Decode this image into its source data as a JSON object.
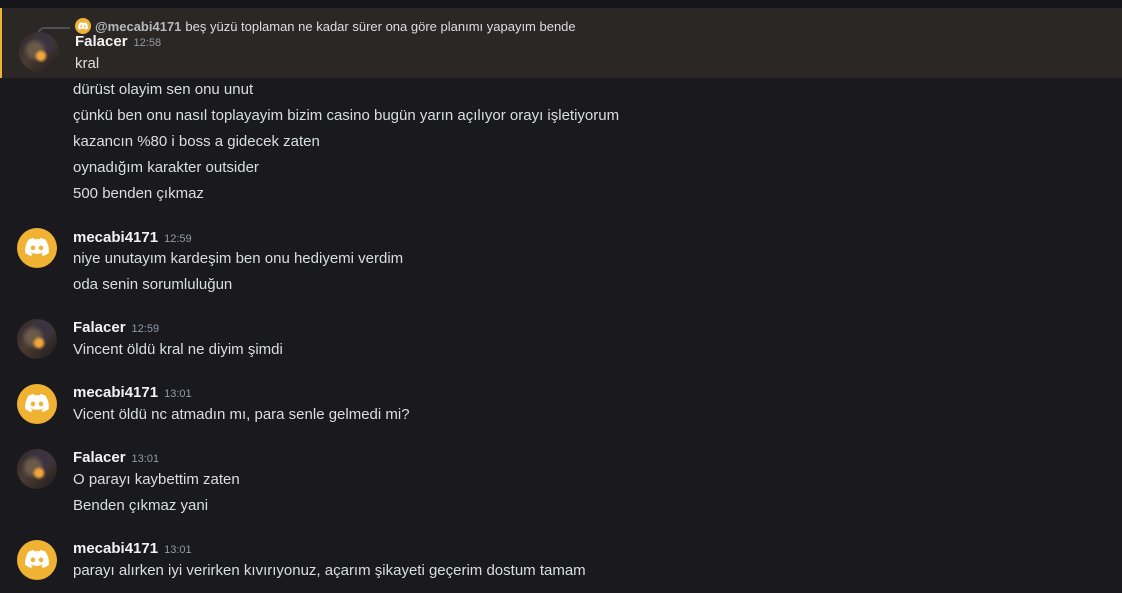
{
  "reply": {
    "username": "@mecabi4171",
    "text": "beş yüzü toplaman ne kadar sürer ona göre planımı yapayım bende"
  },
  "messages": [
    {
      "username": "Falacer",
      "time": "12:58",
      "avatar": "character-portrait",
      "lines": [
        "kral",
        "dürüst olayim sen onu unut",
        "çünkü ben onu nasıl toplayayim bizim casino bugün yarın açılıyor orayı işletiyorum",
        "kazancın %80 i boss a gidecek zaten",
        "oynadığım karakter outsider",
        "500 benden çıkmaz"
      ]
    },
    {
      "username": "mecabi4171",
      "time": "12:59",
      "avatar": "discord-logo",
      "lines": [
        "niye unutayım kardeşim ben onu hediyemi verdim",
        "oda senin sorumluluğun"
      ]
    },
    {
      "username": "Falacer",
      "time": "12:59",
      "avatar": "character-portrait",
      "lines": [
        "Vincent öldü kral ne diyim şimdi"
      ]
    },
    {
      "username": "mecabi4171",
      "time": "13:01",
      "avatar": "discord-logo",
      "lines": [
        "Vicent öldü nc atmadın mı, para senle gelmedi mi?"
      ]
    },
    {
      "username": "Falacer",
      "time": "13:01",
      "avatar": "character-portrait",
      "lines": [
        "O parayı kaybettim zaten",
        "Benden çıkmaz yani"
      ]
    },
    {
      "username": "mecabi4171",
      "time": "13:01",
      "avatar": "discord-logo",
      "lines": [
        "parayı alırken iyi verirken kıvırıyonuz, açarım şikayeti geçerim dostum tamam"
      ]
    }
  ],
  "colors": {
    "background": "#1a1a1e",
    "highlight": "#2a2724",
    "highlight_bar": "#f0b232",
    "discord_avatar": "#f0b232"
  }
}
